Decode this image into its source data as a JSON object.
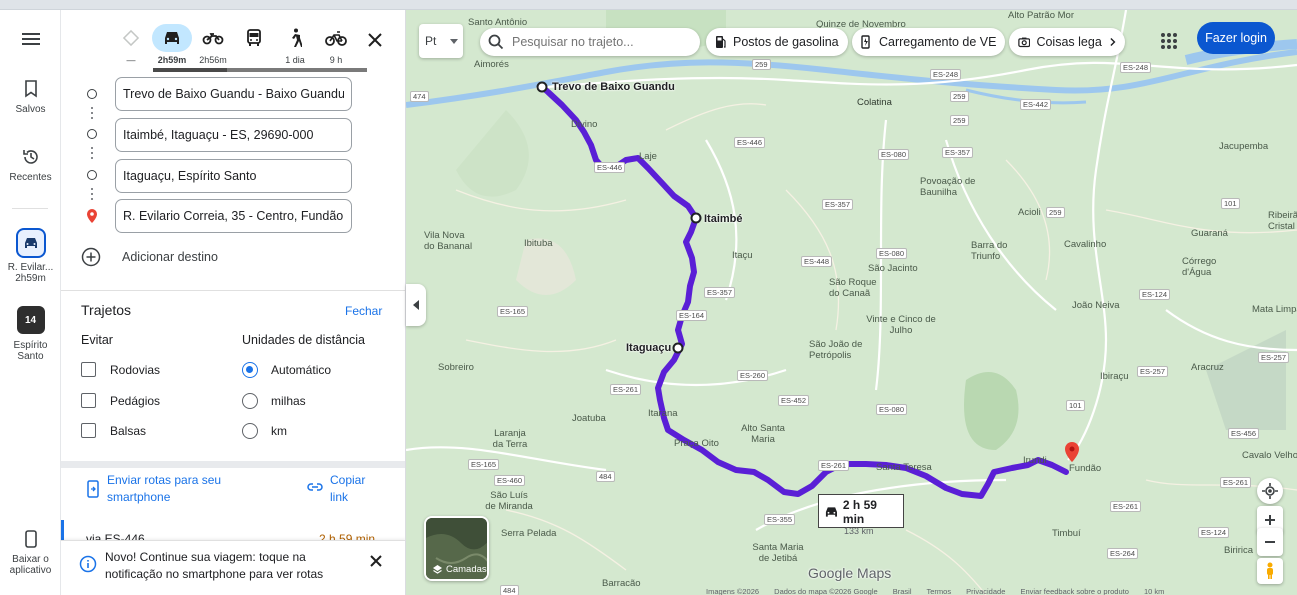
{
  "rail": {
    "saved": "Salvos",
    "recent": "Recentes",
    "recent_item_label": "R. Evilar...",
    "recent_item_time": "2h59m",
    "state_badge": "14",
    "state_label_1": "Espírito",
    "state_label_2": "Santo",
    "download_1": "Baixar o",
    "download_2": "aplicativo"
  },
  "modes": [
    {
      "name": "best",
      "label": "—",
      "icon": "diamond-route-icon"
    },
    {
      "name": "car",
      "label": "2h59m",
      "icon": "car-icon"
    },
    {
      "name": "motorcycle",
      "label": "2h56m",
      "icon": "motorcycle-icon"
    },
    {
      "name": "transit",
      "label": "",
      "icon": "bus-icon"
    },
    {
      "name": "walk",
      "label": "1 dia",
      "icon": "walk-icon"
    },
    {
      "name": "bike",
      "label": "9 h",
      "icon": "bike-icon"
    }
  ],
  "stops": [
    "Trevo de Baixo Guandu - Baixo Guandu, ES",
    "Itaimbé, Itaguaçu - ES, 29690-000",
    "Itaguaçu, Espírito Santo",
    "R. Evilario Correia, 35 - Centro, Fundão - ES"
  ],
  "add_destination": "Adicionar destino",
  "options": {
    "title": "Trajetos",
    "close": "Fechar",
    "avoid_title": "Evitar",
    "avoid": [
      "Rodovias",
      "Pedágios",
      "Balsas"
    ],
    "units_title": "Unidades de distância",
    "units": [
      "Automático",
      "milhas",
      "km"
    ],
    "selected_unit": "Automático"
  },
  "share": {
    "send_1": "Enviar rotas para seu",
    "send_2": "smartphone",
    "copy_1": "Copiar",
    "copy_2": "link"
  },
  "route_peek": {
    "via": "via ES-446",
    "time": "2 h 59 min"
  },
  "notification": {
    "text": "Novo! Continue sua viagem: toque na notificação no smartphone para ver rotas"
  },
  "map": {
    "lang_label": "Pt",
    "search_placeholder": "Pesquisar no trajeto...",
    "chips": [
      "Postos de gasolina",
      "Carregamento de VE",
      "Coisas lega"
    ],
    "login": "Fazer login",
    "duration": "2 h 59 min",
    "distance": "133 km",
    "layers": "Camadas",
    "logo": "Google Maps",
    "route_color": "#5a1fd6",
    "main_places": {
      "start": "Trevo de Baixo Guandu",
      "itaimbe": "Itaimbé",
      "itaguacu": "Itaguaçu"
    },
    "towns": [
      "Santo Antônio",
      "Aimorés",
      "Quinze de Novembro",
      "Alto Patrão Mor",
      "Colatina",
      "Divino",
      "Laje",
      "Jacupemba",
      "Povoação de Baunilha",
      "Acioli",
      "Vila Nova do Bananal",
      "Ibituba",
      "Itaçu",
      "Barra do Triunfo",
      "Cavalinho",
      "Guaraná",
      "Ribeirão Cristal",
      "Córrego d'Água",
      "São Roque do Canaã",
      "São Jacinto",
      "João Neiva",
      "Mata Limpa",
      "Vinte e Cinco de Julho",
      "São João de Petrópolis",
      "Sobreiro",
      "Ibiraçu",
      "Aracruz",
      "Itarana",
      "Joatuba",
      "Alto Santa Maria",
      "Laranja da Terra",
      "Praça Oito",
      "Santa Teresa",
      "Irundi",
      "Fundão",
      "Cavalo Velho",
      "São Luís de Miranda",
      "Serra Pelada",
      "Santa Maria de Jetibá",
      "Timbuí",
      "Barracão",
      "Biririca"
    ],
    "shields": [
      "ES-446",
      "ES-164",
      "ES-357",
      "ES-261",
      "ES-080",
      "ES-448",
      "ES-260",
      "ES-452",
      "ES-165",
      "ES-460",
      "ES-355",
      "ES-248",
      "ES-442",
      "ES-124",
      "ES-257",
      "ES-456",
      "ES-264",
      "259",
      "474",
      "101",
      "484"
    ],
    "footer": [
      "Imagens ©2026",
      "Dados do mapa ©2026 Google",
      "Brasil",
      "Termos",
      "Privacidade",
      "Enviar feedback sobre o produto",
      "10 km"
    ]
  }
}
